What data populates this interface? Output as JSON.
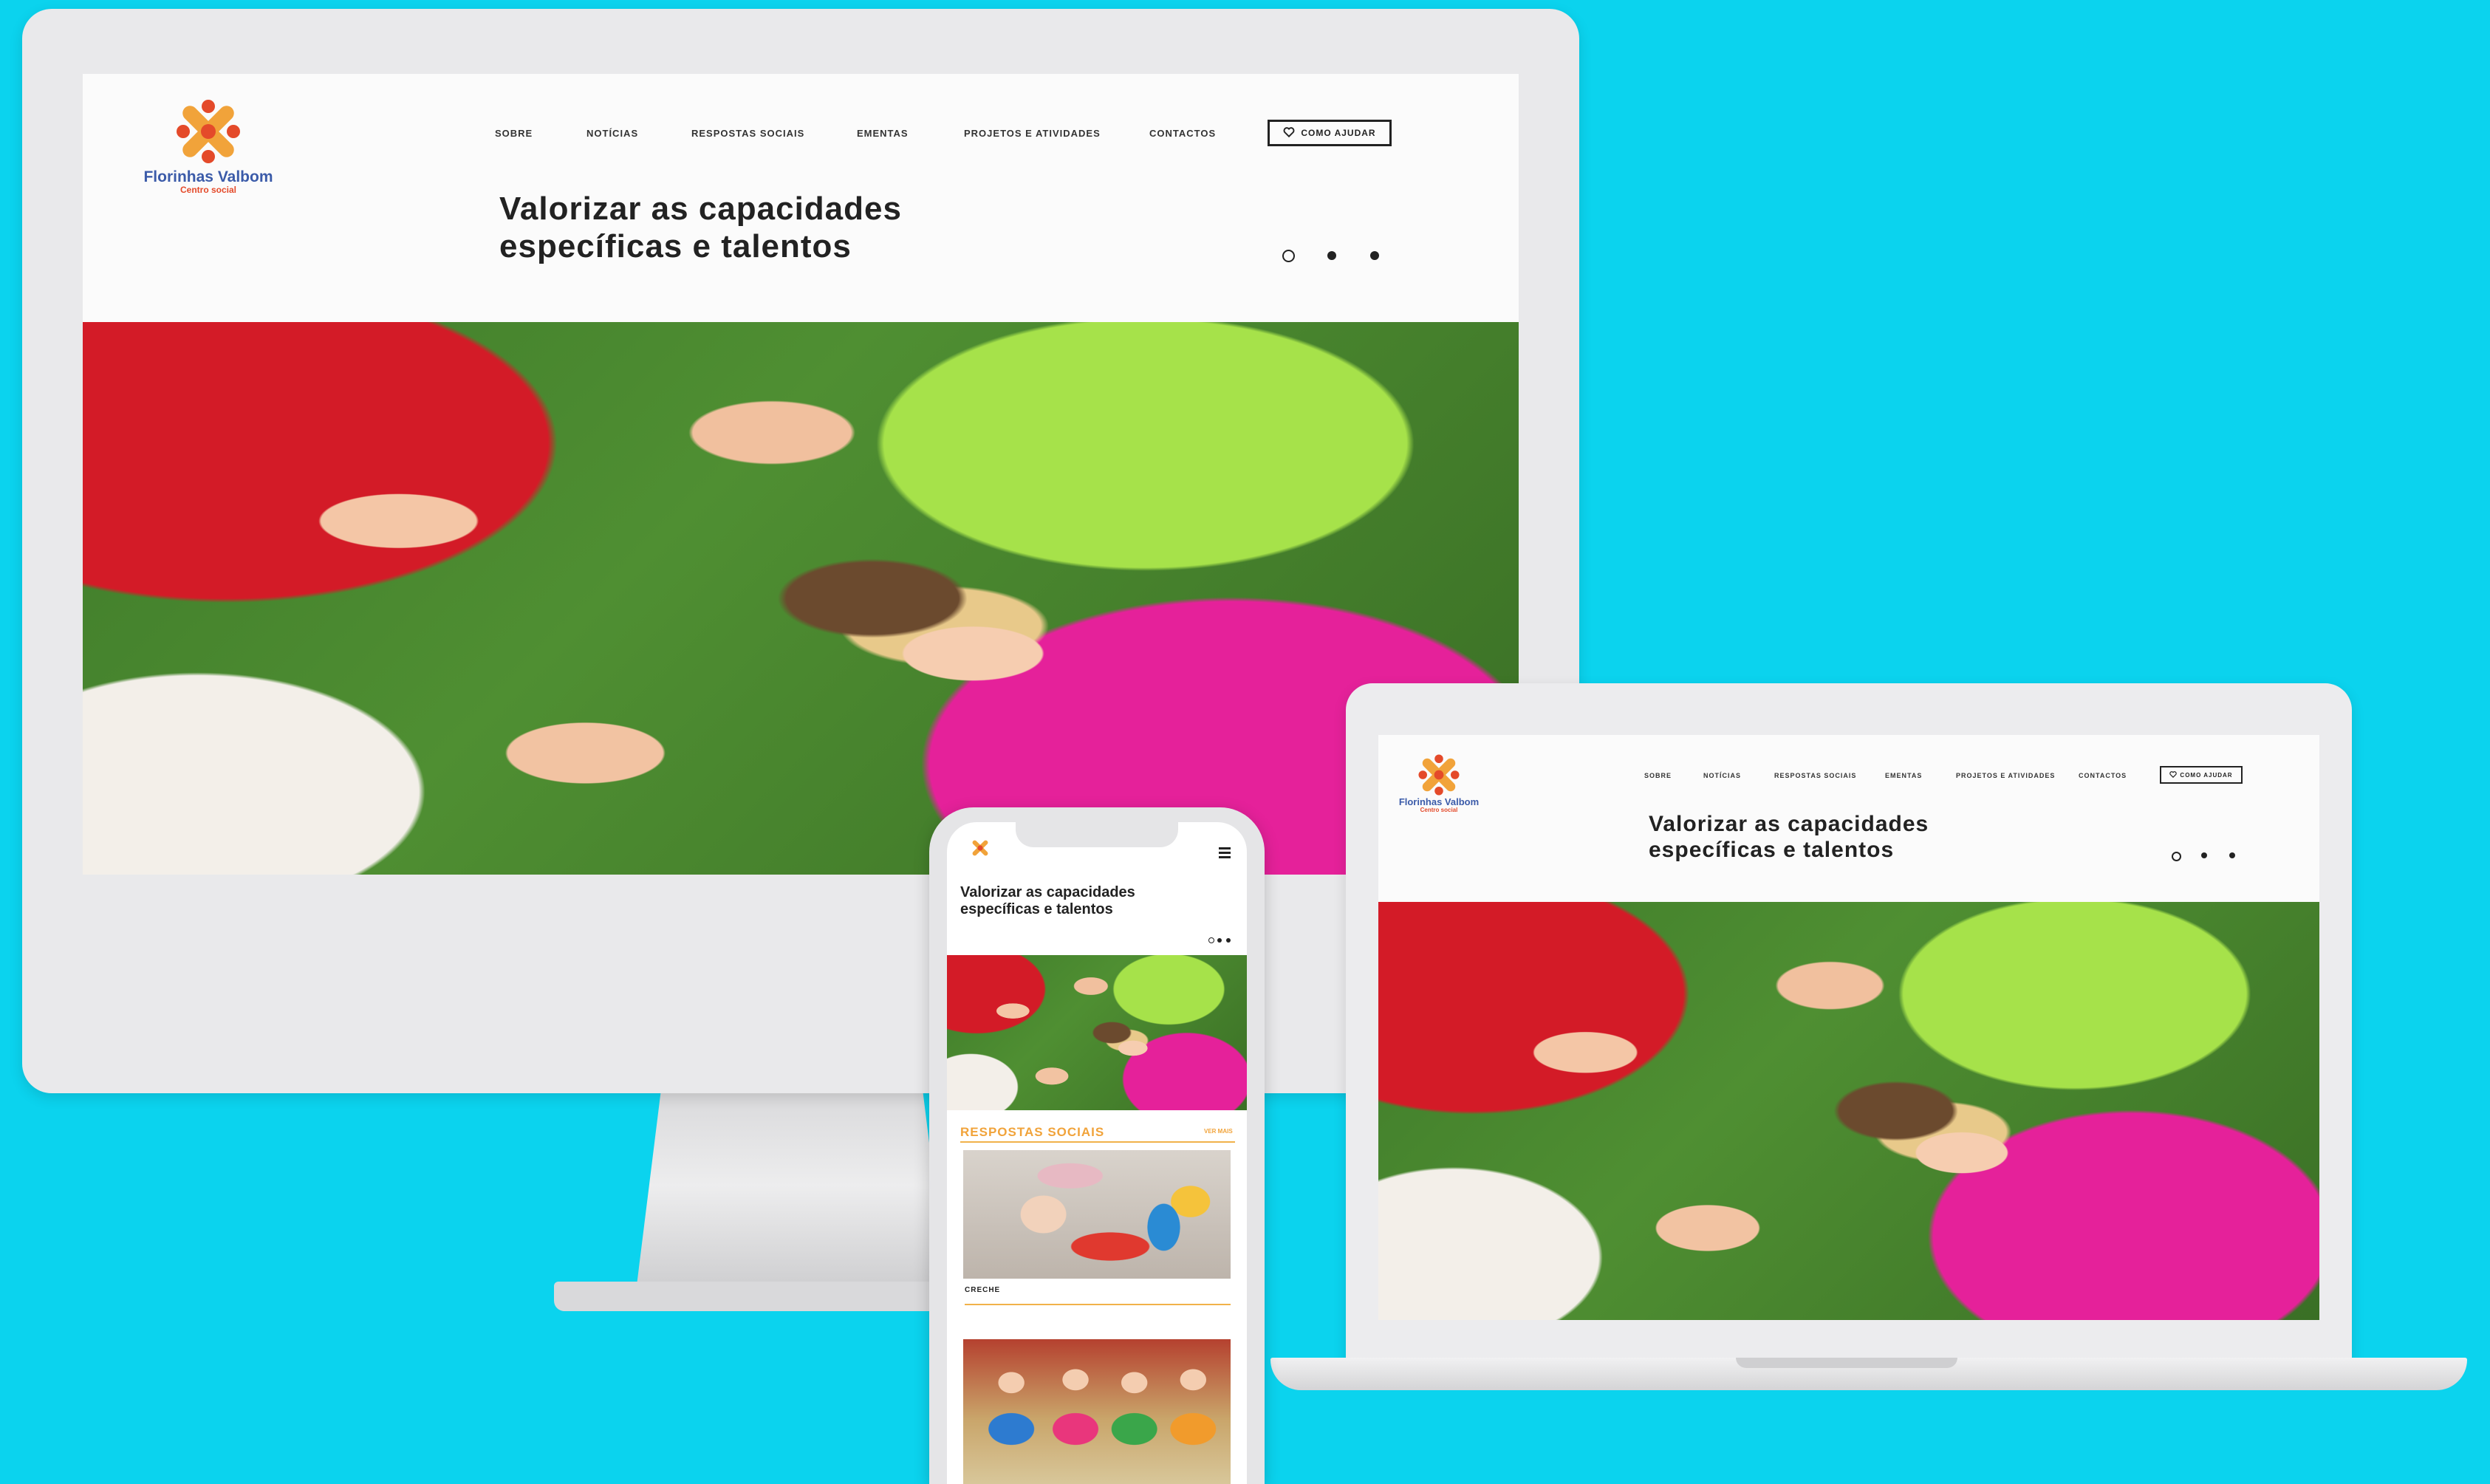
{
  "brand": {
    "name": "Florinhas Valbom",
    "subtitle": "Centro social",
    "colors": {
      "orange": "#f1a33a",
      "red": "#e44a2a",
      "blue": "#3b5ba9",
      "background": "#0bd3ee"
    }
  },
  "nav": {
    "items": [
      "SOBRE",
      "NOTÍCIAS",
      "RESPOSTAS SOCIAIS",
      "EMENTAS",
      "PROJETOS E ATIVIDADES",
      "CONTACTOS"
    ],
    "help_button": "COMO AJUDAR",
    "help_icon": "heart-icon"
  },
  "hero": {
    "title_line1": "Valorizar as capacidades",
    "title_line2": "específicas e talentos",
    "slides_total": 3,
    "slide_active": 1
  },
  "mobile": {
    "menu_icon": "hamburger-icon",
    "section_title": "RESPOSTAS SOCIAIS",
    "section_link": "VER MAIS",
    "card1_label": "CRECHE"
  }
}
